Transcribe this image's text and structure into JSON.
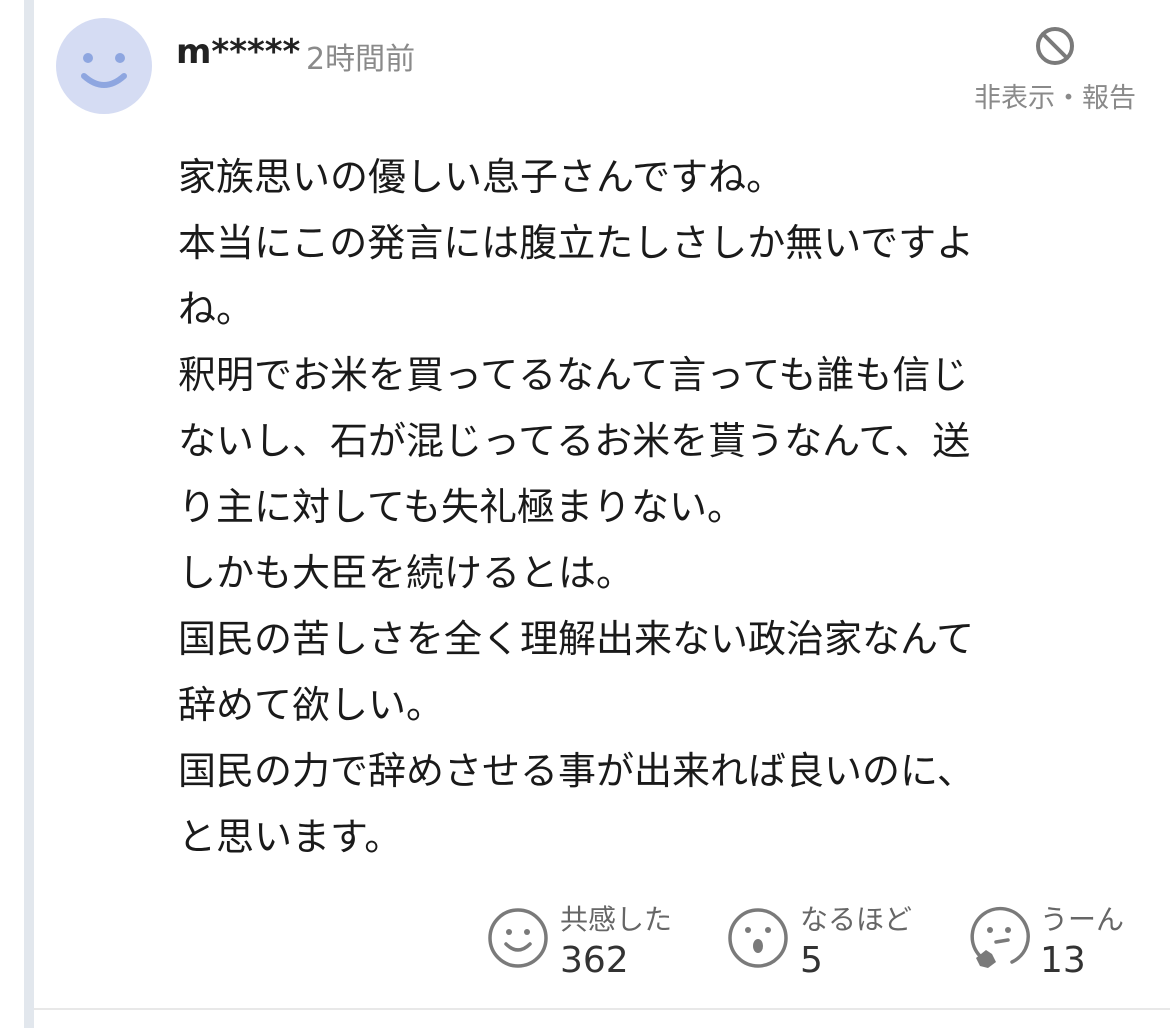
{
  "comment": {
    "username": "m*****",
    "timestamp": "2時間前",
    "report_label": "非表示・報告",
    "icons": {
      "avatar": "smiley-avatar-icon",
      "report": "prohibited-icon"
    },
    "body_lines": [
      "家族思いの優しい息子さんですね。",
      "本当にこの発言には腹立たしさしか無いですよ",
      "ね。",
      "釈明でお米を買ってるなんて言っても誰も信じ",
      "ないし、石が混じってるお米を貰うなんて、送",
      "り主に対しても失礼極まりない。",
      "しかも大臣を続けるとは。",
      "国民の苦しさを全く理解出来ない政治家なんて",
      "辞めて欲しい。",
      "国民の力で辞めさせる事が出来れば良いのに、",
      "と思います。"
    ],
    "reactions": [
      {
        "label": "共感した",
        "count": "362",
        "icon": "smile-face-icon"
      },
      {
        "label": "なるほど",
        "count": "5",
        "icon": "surprised-face-icon"
      },
      {
        "label": "うーん",
        "count": "13",
        "icon": "thinking-face-icon"
      }
    ]
  },
  "colors": {
    "avatar_bg": "#d5dcf3",
    "avatar_features": "#8ea6e0",
    "muted_text": "#8a8a8a",
    "body_text": "#1a1a1a",
    "rail": "#e2e7ed"
  }
}
